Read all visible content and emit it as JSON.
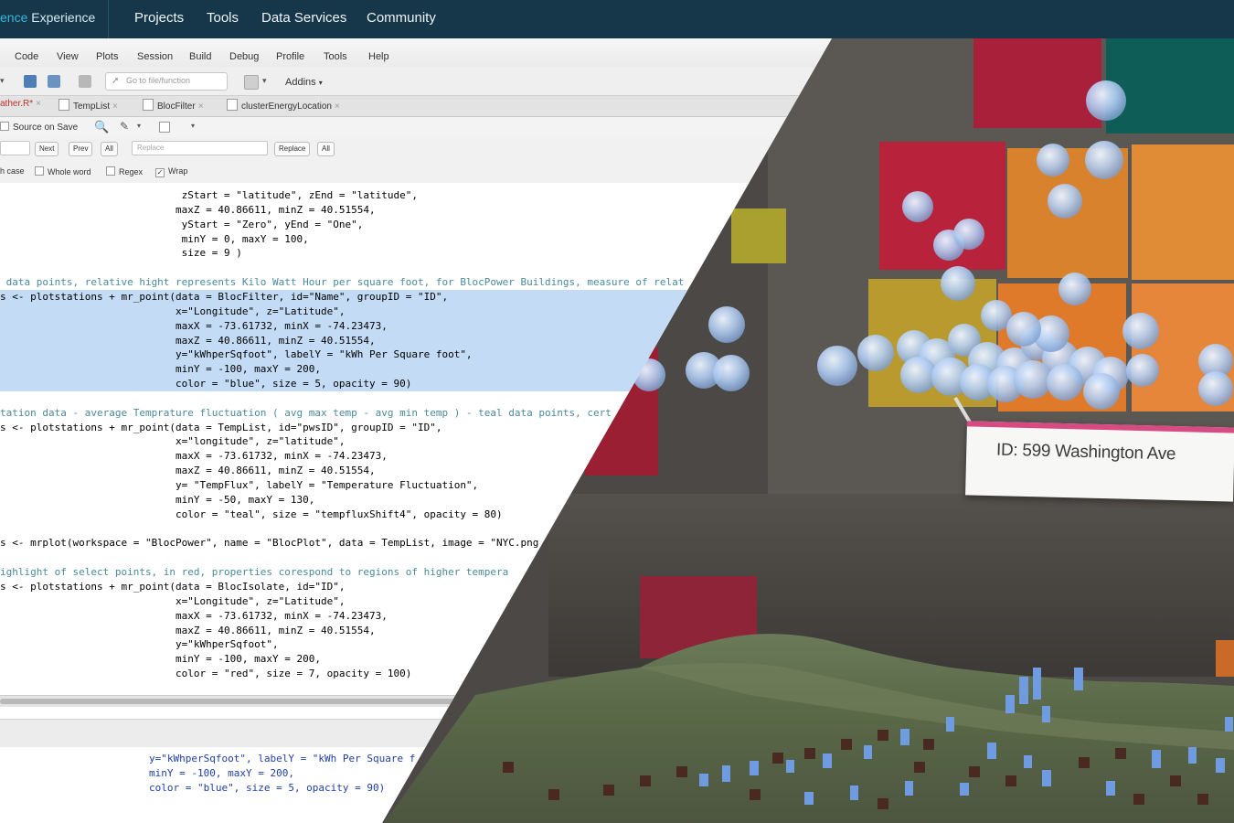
{
  "header": {
    "brand_part1": "ence",
    "brand_part2": "Experience",
    "nav": [
      "Projects",
      "Tools",
      "Data Services",
      "Community"
    ]
  },
  "ide": {
    "menu": [
      "Code",
      "View",
      "Plots",
      "Session",
      "Build",
      "Debug",
      "Profile",
      "Tools",
      "Help"
    ],
    "toolbar": {
      "goto_placeholder": "Go to file/function",
      "addins": "Addins"
    },
    "tabs": [
      {
        "label": "ather.R*",
        "active": true
      },
      {
        "label": "TempList",
        "active": false
      },
      {
        "label": "BlocFilter",
        "active": false
      },
      {
        "label": "clusterEnergyLocation",
        "active": false
      }
    ],
    "source_on_save": "Source on Save",
    "find": {
      "next": "Next",
      "prev": "Prev",
      "all": "All",
      "replace_placeholder": "Replace",
      "replace_btn": "Replace",
      "replace_all": "All"
    },
    "options": {
      "match_case": "h case",
      "whole_word": "Whole word",
      "regex": "Regex",
      "wrap": "Wrap"
    },
    "code_lines": [
      {
        "text": "                              zStart = \"latitude\", zEnd = \"latitude\",",
        "kind": "code"
      },
      {
        "text": "                             maxZ = 40.86611, minZ = 40.51554,",
        "kind": "code"
      },
      {
        "text": "                              yStart = \"Zero\", yEnd = \"One\",",
        "kind": "code"
      },
      {
        "text": "                              minY = 0, maxY = 100,",
        "kind": "code"
      },
      {
        "text": "                              size = 9 )",
        "kind": "code"
      },
      {
        "text": "",
        "kind": "code"
      },
      {
        "text": " data points, relative hight represents Kilo Watt Hour per square foot, for BlocPower Buildings, measure of relat",
        "kind": "comment"
      },
      {
        "text": "s <- plotstations + mr_point(data = BlocFilter, id=\"Name\", groupID = \"ID\",",
        "kind": "sel"
      },
      {
        "text": "                             x=\"Longitude\", z=\"Latitude\",",
        "kind": "sel"
      },
      {
        "text": "                             maxX = -73.61732, minX = -74.23473,",
        "kind": "sel"
      },
      {
        "text": "                             maxZ = 40.86611, minZ = 40.51554,",
        "kind": "sel"
      },
      {
        "text": "                             y=\"kWhperSqfoot\", labelY = \"kWh Per Square foot\",",
        "kind": "sel"
      },
      {
        "text": "                             minY = -100, maxY = 200,",
        "kind": "sel"
      },
      {
        "text": "                             color = \"blue\", size = 5, opacity = 90)",
        "kind": "sel"
      },
      {
        "text": "",
        "kind": "code"
      },
      {
        "text": "tation data - average Temprature fluctuation ( avg max temp - avg min temp ) - teal data points, cert",
        "kind": "comment"
      },
      {
        "text": "s <- plotstations + mr_point(data = TempList, id=\"pwsID\", groupID = \"ID\",",
        "kind": "code"
      },
      {
        "text": "                             x=\"longitude\", z=\"latitude\",",
        "kind": "code"
      },
      {
        "text": "                             maxX = -73.61732, minX = -74.23473,",
        "kind": "code"
      },
      {
        "text": "                             maxZ = 40.86611, minZ = 40.51554,",
        "kind": "code"
      },
      {
        "text": "                             y= \"TempFlux\", labelY = \"Temperature Fluctuation\",",
        "kind": "code"
      },
      {
        "text": "                             minY = -50, maxY = 130,",
        "kind": "code"
      },
      {
        "text": "                             color = \"teal\", size = \"tempfluxShift4\", opacity = 80)",
        "kind": "code"
      },
      {
        "text": "",
        "kind": "code"
      },
      {
        "text": "s <- mrplot(workspace = \"BlocPower\", name = \"BlocPlot\", data = TempList, image = \"NYC.png",
        "kind": "code"
      },
      {
        "text": "",
        "kind": "code"
      },
      {
        "text": "ighlight of select points, in red, properties corespond to regions of higher tempera",
        "kind": "comment"
      },
      {
        "text": "s <- plotstations + mr_point(data = BlocIsolate, id=\"ID\",",
        "kind": "code"
      },
      {
        "text": "                             x=\"Longitude\", z=\"Latitude\",",
        "kind": "code"
      },
      {
        "text": "                             maxX = -73.61732, minX = -74.23473,",
        "kind": "code"
      },
      {
        "text": "                             maxZ = 40.86611, minZ = 40.51554,",
        "kind": "code"
      },
      {
        "text": "                             y=\"kWhperSqfoot\",",
        "kind": "code"
      },
      {
        "text": "                             minY = -100, maxY = 200,",
        "kind": "code"
      },
      {
        "text": "                             color = \"red\", size = 7, opacity = 100)",
        "kind": "code"
      }
    ],
    "console_lines": [
      "y=\"kWhperSqfoot\", labelY = \"kWh Per Square f",
      "minY = -100, maxY = 200,",
      "color = \"blue\", size = 5, opacity = 90)"
    ]
  },
  "scene": {
    "pin_label": "ID: 599 Washington Ave",
    "colors": {
      "wall": "#4a4744",
      "sticky_red": "#b8233e",
      "sticky_orange": "#e07a2a",
      "sticky_yellow": "#c9a83a",
      "sticky_teal": "#0f6b63",
      "sphere": "#b7cff0",
      "bar_blue": "#6f9be0",
      "bar_brown": "#4a2a20"
    }
  }
}
